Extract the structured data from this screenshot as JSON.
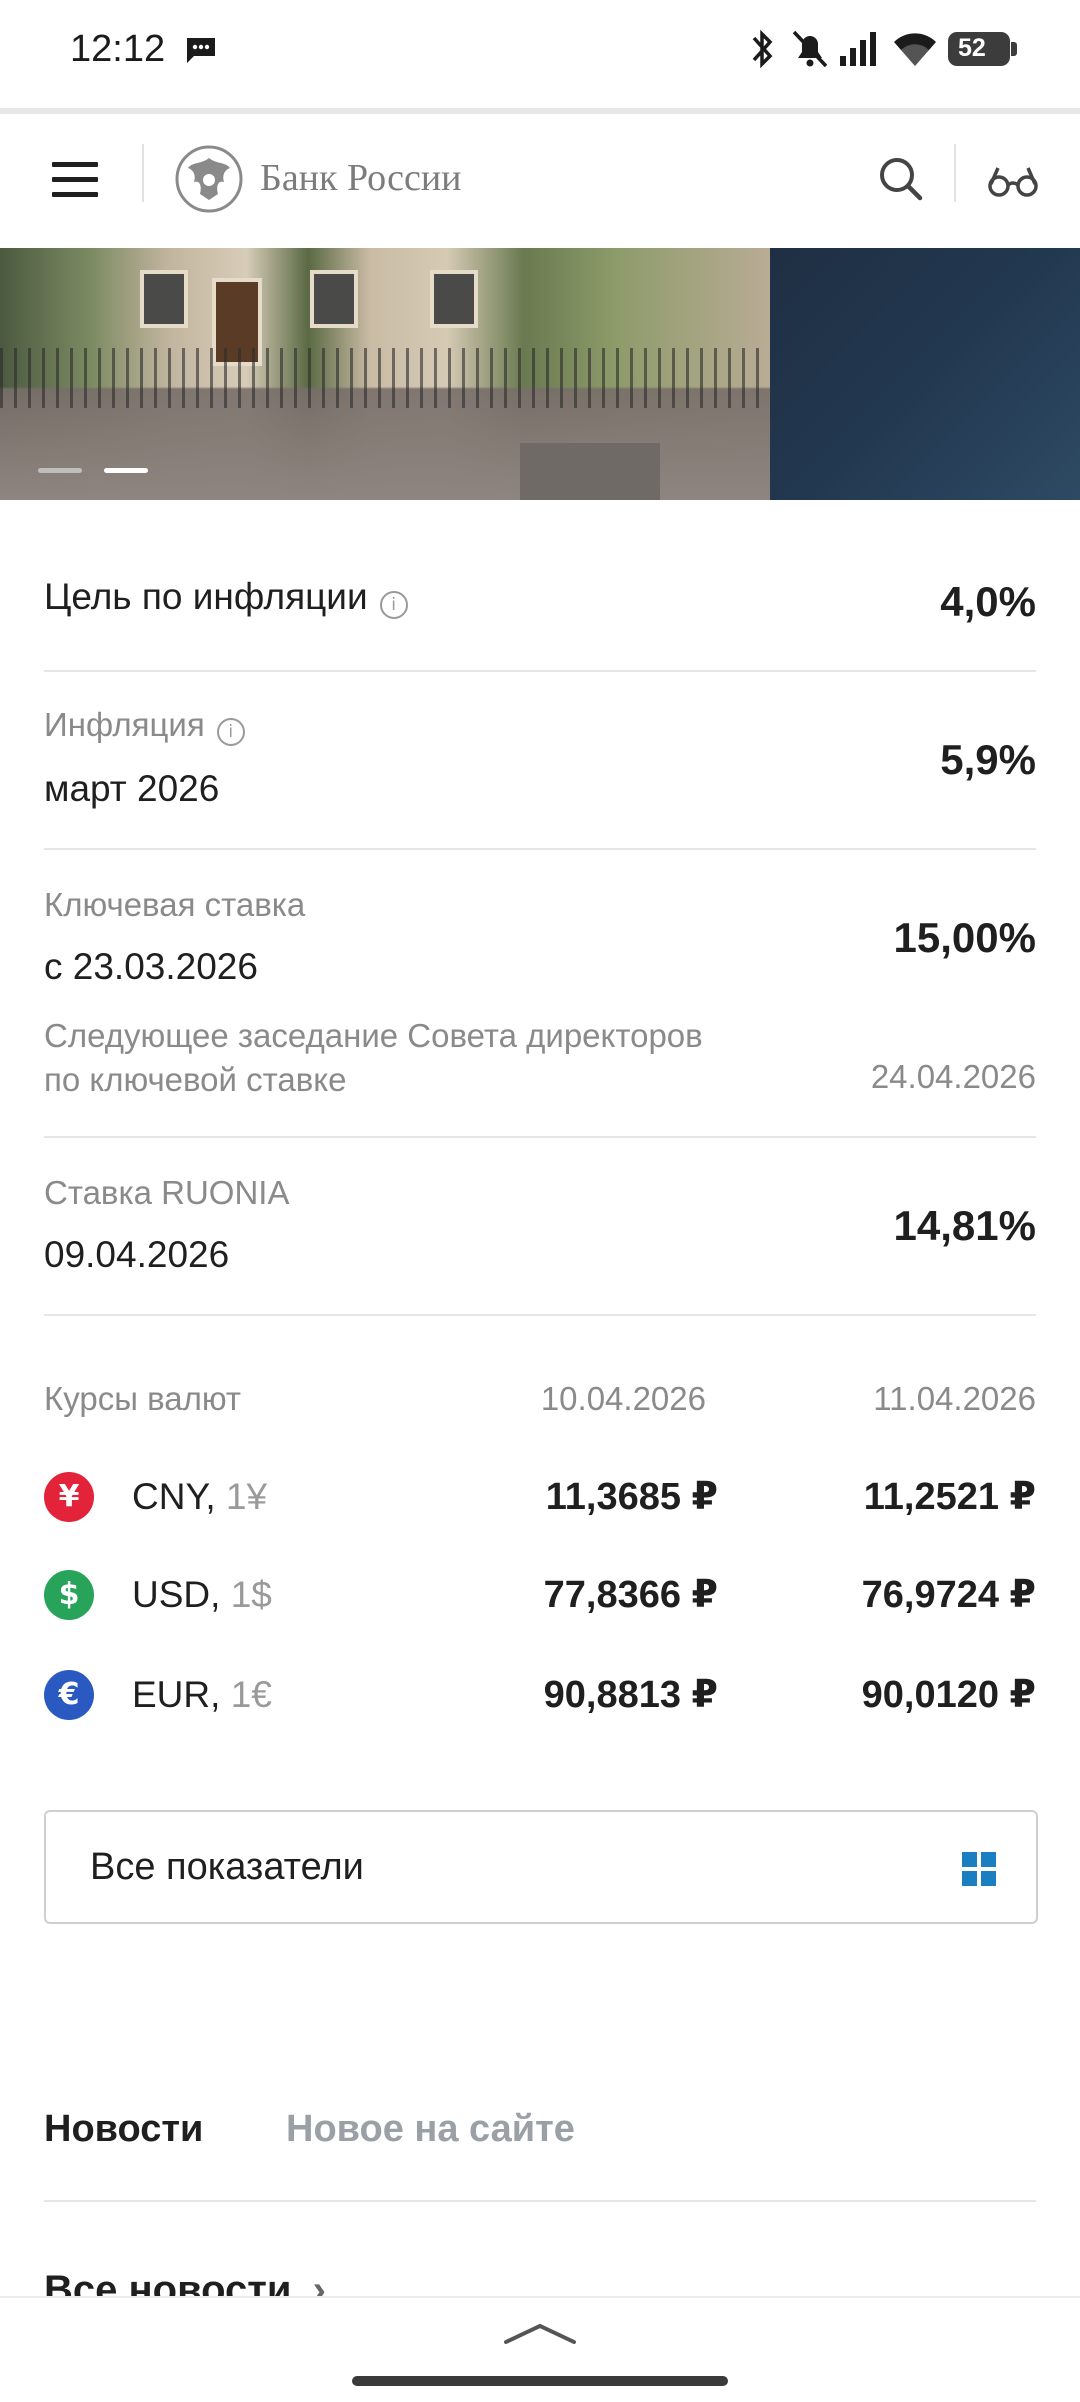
{
  "status_bar": {
    "time": "12:12",
    "battery": "52"
  },
  "header": {
    "bank_name": "Банк России"
  },
  "indicators": {
    "inflation_target": {
      "label": "Цель по инфляции",
      "value": "4,0%"
    },
    "inflation": {
      "label": "Инфляция",
      "period": "март 2026",
      "value": "5,9%"
    },
    "key_rate": {
      "label": "Ключевая ставка",
      "since": "с 23.03.2026",
      "value": "15,00%",
      "next_meeting_line1": "Следующее заседание Совета директоров",
      "next_meeting_line2": "по ключевой ставке",
      "next_meeting_date": "24.04.2026"
    },
    "ruonia": {
      "label": "Ставка RUONIA",
      "date": "09.04.2026",
      "value": "14,81%"
    }
  },
  "currency": {
    "title": "Курсы валют",
    "date1": "10.04.2026",
    "date2": "11.04.2026",
    "rows": [
      {
        "symbol": "¥",
        "code": "CNY,",
        "unit": "1¥",
        "v1": "11,3685 ₽",
        "v2": "11,2521 ₽",
        "color": "#e3233a"
      },
      {
        "symbol": "$",
        "code": "USD,",
        "unit": "1$",
        "v1": "77,8366 ₽",
        "v2": "76,9724 ₽",
        "color": "#27a35a"
      },
      {
        "symbol": "€",
        "code": "EUR,",
        "unit": "1€",
        "v1": "90,8813 ₽",
        "v2": "90,0120 ₽",
        "color": "#2a59c2"
      }
    ]
  },
  "all_indicators_button": "Все показатели",
  "tabs": [
    {
      "label": "Новости",
      "active": true
    },
    {
      "label": "Новое на сайте",
      "active": false
    }
  ],
  "all_news_link": "Все новости",
  "colors": {
    "accent": "#1a7fc1",
    "text": "#1f1f1f",
    "muted": "#8a8a8a"
  }
}
